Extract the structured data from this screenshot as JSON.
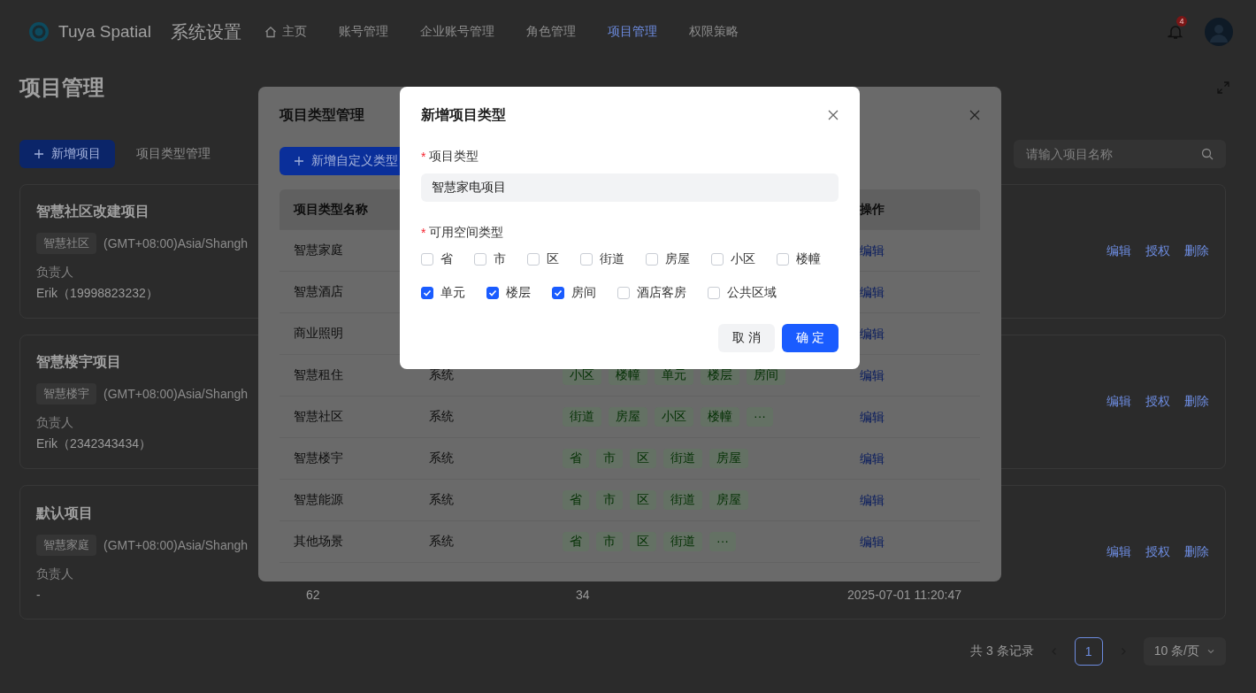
{
  "header": {
    "brand": "Tuya Spatial",
    "app_title": "系统设置",
    "nav": [
      {
        "label": "主页",
        "selected": false
      },
      {
        "label": "账号管理",
        "selected": false
      },
      {
        "label": "企业账号管理",
        "selected": false
      },
      {
        "label": "角色管理",
        "selected": false
      },
      {
        "label": "项目管理",
        "selected": true
      },
      {
        "label": "权限策略",
        "selected": false
      }
    ],
    "notification_badge": "4"
  },
  "page": {
    "title": "项目管理",
    "actions": [
      {
        "label": "新增项目",
        "kind": "primary"
      },
      {
        "label": "项目类型管理",
        "kind": "text"
      }
    ],
    "search": {
      "placeholder": "请输入项目名称"
    }
  },
  "projects": [
    {
      "name": "智慧社区改建项目",
      "type_tag": "智慧社区",
      "timezone": "(GMT+08:00)Asia/Shangh",
      "owner_label": "负责人",
      "owner": "Erik（19998823232）",
      "actions": [
        "编辑",
        "授权",
        "删除"
      ]
    },
    {
      "name": "智慧楼宇项目",
      "type_tag": "智慧楼宇",
      "timezone": "(GMT+08:00)Asia/Shangh",
      "owner_label": "负责人",
      "owner": "Erik（2342343434）",
      "actions": [
        "编辑",
        "授权",
        "删除"
      ]
    },
    {
      "name": "默认项目",
      "type_tag": "智慧家庭",
      "timezone": "(GMT+08:00)Asia/Shangh",
      "owner_label": "负责人",
      "owner": "-",
      "stats": [
        "62",
        "34",
        "2025-07-01 11:20:47"
      ],
      "actions": [
        "编辑",
        "授权",
        "删除"
      ]
    }
  ],
  "pagination": {
    "total": "共 3 条记录",
    "pages": [
      {
        "label": "1",
        "selected": true
      }
    ],
    "page_size": "10 条/页"
  },
  "type_dialog": {
    "title": "项目类型管理",
    "add_button": "新增自定义类型",
    "columns": {
      "name": "项目类型名称",
      "actions": "操作"
    },
    "rows": [
      {
        "name": "智慧家庭",
        "action": "编辑"
      },
      {
        "name": "智慧酒店",
        "action": "编辑"
      },
      {
        "name": "商业照明",
        "action": "编辑"
      },
      {
        "name": "智慧租住",
        "source": "系统",
        "tags": [
          "小区",
          "楼幢",
          "单元",
          "楼层",
          "房间"
        ],
        "action": "编辑"
      },
      {
        "name": "智慧社区",
        "source": "系统",
        "tags": [
          "街道",
          "房屋",
          "小区",
          "楼幢",
          "···"
        ],
        "action": "编辑"
      },
      {
        "name": "智慧楼宇",
        "source": "系统",
        "tags": [
          "省",
          "市",
          "区",
          "街道",
          "房屋"
        ],
        "action": "编辑"
      },
      {
        "name": "智慧能源",
        "source": "系统",
        "tags": [
          "省",
          "市",
          "区",
          "街道",
          "房屋"
        ],
        "action": "编辑"
      },
      {
        "name": "其他场景",
        "source": "系统",
        "tags": [
          "省",
          "市",
          "区",
          "街道",
          "···"
        ],
        "action": "编辑"
      }
    ]
  },
  "add_dialog": {
    "title": "新增项目类型",
    "type_field": {
      "required_mark": "*",
      "label": "项目类型",
      "value": "智慧家电项目"
    },
    "space_types": {
      "required_mark": "*",
      "label": "可用空间类型",
      "options": [
        {
          "label": "省",
          "checked": false
        },
        {
          "label": "市",
          "checked": false
        },
        {
          "label": "区",
          "checked": false
        },
        {
          "label": "街道",
          "checked": false
        },
        {
          "label": "房屋",
          "checked": false
        },
        {
          "label": "小区",
          "checked": false
        },
        {
          "label": "楼幢",
          "checked": false
        },
        {
          "label": "单元",
          "checked": true
        },
        {
          "label": "楼层",
          "checked": true
        },
        {
          "label": "房间",
          "checked": true
        },
        {
          "label": "酒店客房",
          "checked": false
        },
        {
          "label": "公共区域",
          "checked": false
        }
      ]
    },
    "buttons": [
      {
        "label": "取 消",
        "kind": "default"
      },
      {
        "label": "确 定",
        "kind": "primary"
      }
    ]
  }
}
